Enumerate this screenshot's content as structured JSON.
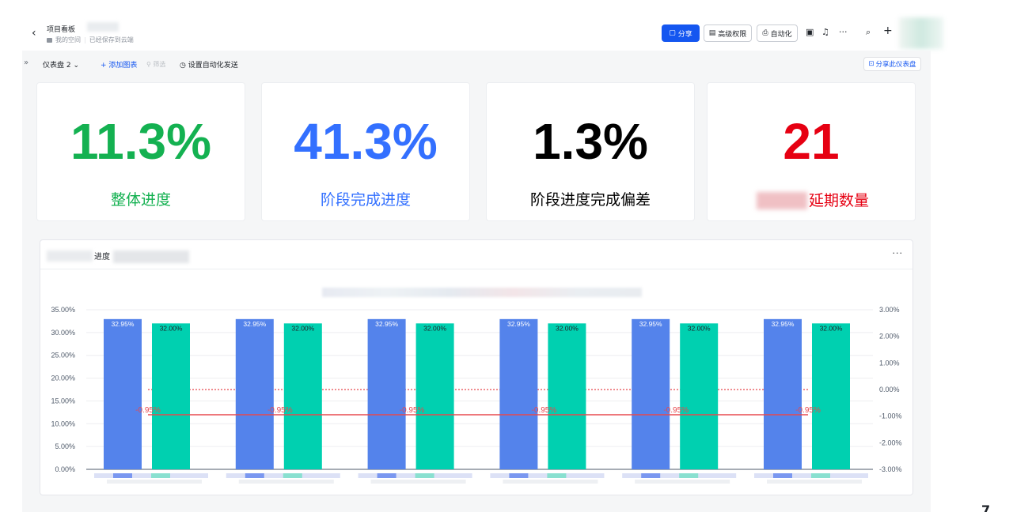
{
  "header": {
    "title": "项目看板",
    "breadcrumb_space": "我的空间",
    "save_status": "已经保存到云端",
    "share_label": "分享",
    "permission_label": "高级权限",
    "automation_label": "自动化",
    "more_label": "···"
  },
  "toolbar": {
    "dashboard_name": "仪表盘 2",
    "add_chart_label": "添加图表",
    "filter_label": "筛选",
    "auto_send_label": "设置自动化发送",
    "share_dashboard_label": "分享此仪表盘"
  },
  "kpis": [
    {
      "value": "11.3%",
      "label": "整体进度",
      "color": "#14b151"
    },
    {
      "value": "41.3%",
      "label": "阶段完成进度",
      "color": "#3370ff"
    },
    {
      "value": "1.3%",
      "label": "阶段进度完成偏差",
      "color": "#000000"
    },
    {
      "value": "21",
      "label": "延期数量",
      "color": "#e60012"
    }
  ],
  "panel": {
    "title": "进度",
    "more_label": "···"
  },
  "chart_data": {
    "type": "bar",
    "categories": [
      "",
      "",
      "",
      "",
      "",
      ""
    ],
    "series": [
      {
        "values": [
          32.95,
          32.95,
          32.95,
          32.95,
          32.95,
          32.95
        ],
        "labels": [
          "32.95%",
          "32.95%",
          "32.95%",
          "32.95%",
          "32.95%",
          "32.95%"
        ],
        "color": "#5483eb",
        "axis": "left"
      },
      {
        "values": [
          32.0,
          32.0,
          32.0,
          32.0,
          32.0,
          32.0
        ],
        "labels": [
          "32.00%",
          "32.00%",
          "32.00%",
          "32.00%",
          "32.00%",
          "32.00%"
        ],
        "color": "#00d0b0",
        "axis": "left"
      },
      {
        "type": "line",
        "values": [
          -0.95,
          -0.95,
          -0.95,
          -0.95,
          -0.95,
          -0.95
        ],
        "labels": [
          "-0.95%",
          "-0.95%",
          "-0.95%",
          "-0.95%",
          "-0.95%",
          "-0.95%"
        ],
        "color": "#e8484d",
        "axis": "right"
      }
    ],
    "reference_line": {
      "value": 0.0,
      "axis": "right",
      "style": "dotted",
      "color": "#e8484d"
    },
    "left_axis": {
      "ticks": [
        "0.00%",
        "5.00%",
        "10.00%",
        "15.00%",
        "20.00%",
        "25.00%",
        "30.00%",
        "35.00%"
      ],
      "ylim": [
        0,
        35
      ]
    },
    "right_axis": {
      "ticks": [
        "-3.00%",
        "-2.00%",
        "-1.00%",
        "0.00%",
        "1.00%",
        "2.00%",
        "3.00%"
      ],
      "ylim": [
        -3,
        3
      ]
    },
    "grid": true
  },
  "colors": {
    "brand": "#1456f0",
    "background": "#f5f6f7"
  }
}
